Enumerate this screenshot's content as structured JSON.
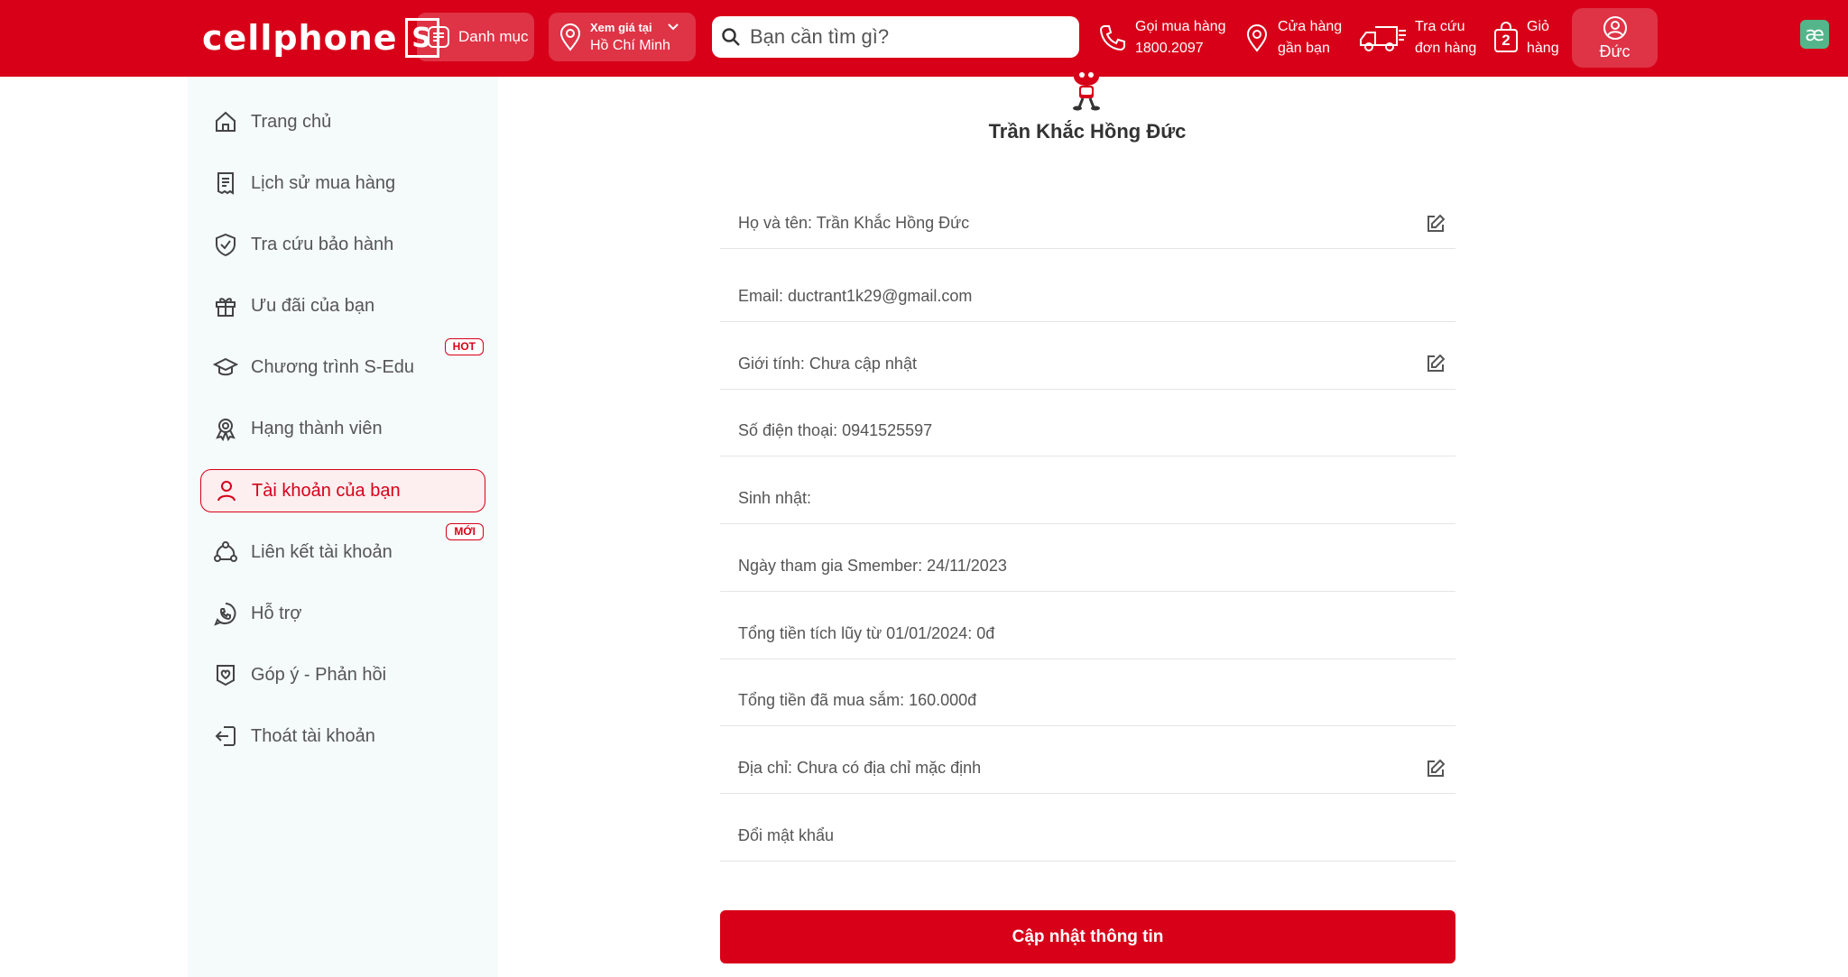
{
  "header": {
    "logo_text": "cellphone",
    "logo_letter": "S",
    "category_label": "Danh mục",
    "location": {
      "line1": "Xem giá tại",
      "line2": "Hồ Chí Minh"
    },
    "search_placeholder": "Bạn cần tìm gì?",
    "hotline": {
      "line1": "Gọi mua hàng",
      "line2": "1800.2097"
    },
    "stores": {
      "line1": "Cửa hàng",
      "line2": "gần bạn"
    },
    "tracking": {
      "line1": "Tra cứu",
      "line2": "đơn hàng"
    },
    "cart": {
      "line1": "Giỏ",
      "line2": "hàng",
      "count": "2"
    },
    "user_name": "Đức",
    "brand_color": "#d70018"
  },
  "sidebar": {
    "items": [
      {
        "label": "Trang chủ",
        "icon": "home-icon"
      },
      {
        "label": "Lịch sử mua hàng",
        "icon": "receipt-icon"
      },
      {
        "label": "Tra cứu bảo hành",
        "icon": "shield-check-icon"
      },
      {
        "label": "Ưu đãi của bạn",
        "icon": "gift-icon"
      },
      {
        "label": "Chương trình S-Edu",
        "icon": "graduation-cap-icon",
        "tag": "HOT"
      },
      {
        "label": "Hạng thành viên",
        "icon": "award-icon"
      },
      {
        "label": "Tài khoản của bạn",
        "icon": "user-icon",
        "active": true
      },
      {
        "label": "Liên kết tài khoản",
        "icon": "link-nodes-icon",
        "tag": "MỚI"
      },
      {
        "label": "Hỗ trợ",
        "icon": "phone-chat-icon"
      },
      {
        "label": "Góp ý - Phản hồi",
        "icon": "heart-shield-icon"
      },
      {
        "label": "Thoát tài khoản",
        "icon": "logout-icon"
      }
    ]
  },
  "profile": {
    "name": "Trần Khắc Hồng Đức",
    "fields": [
      {
        "text": "Họ và tên: Trần Khắc Hồng Đức",
        "editable": true
      },
      {
        "text": "Email: ductrant1k29@gmail.com",
        "editable": false
      },
      {
        "text": "Giới tính: Chưa cập nhật",
        "editable": true
      },
      {
        "text": "Số điện thoại: 0941525597",
        "editable": false
      },
      {
        "text": "Sinh nhật:",
        "editable": false
      },
      {
        "text": "Ngày tham gia Smember: 24/11/2023",
        "editable": false
      },
      {
        "text": "Tổng tiền tích lũy từ 01/01/2024: 0đ",
        "editable": false
      },
      {
        "text": "Tổng tiền đã mua sắm: 160.000đ",
        "editable": false
      },
      {
        "text": "Địa chỉ: Chưa có địa chỉ mặc định",
        "editable": true
      },
      {
        "text": "Đổi mật khẩu",
        "editable": false
      }
    ],
    "update_button": "Cập nhật thông tin"
  },
  "extension_icon": "ae-extension-icon"
}
